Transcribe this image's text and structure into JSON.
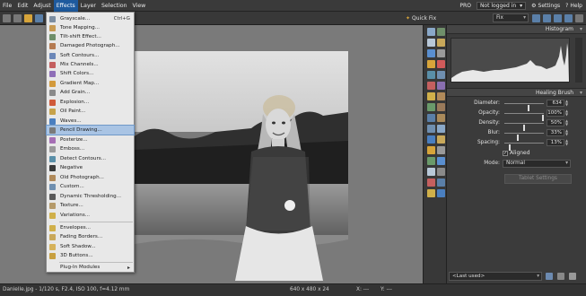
{
  "menubar": {
    "items": [
      "File",
      "Edit",
      "Adjust",
      "Effects",
      "Layer",
      "Selection",
      "View"
    ],
    "pro_label": "PRO",
    "login_label": "Not logged in",
    "settings_label": "Settings",
    "help_label": "Help"
  },
  "toolbar": {
    "quick_fix_label": "Quick Fix",
    "fix_value": "Fix"
  },
  "effects_menu": {
    "items": [
      {
        "label": "Grayscale...",
        "shortcut": "Ctrl+G",
        "color": "#7c8da0"
      },
      {
        "label": "Tone Mapping...",
        "color": "#c79a52"
      },
      {
        "label": "Tilt-shift Effect...",
        "color": "#6f8f6a"
      },
      {
        "label": "Damaged Photograph...",
        "color": "#b57b52"
      },
      {
        "label": "Soft Contours...",
        "color": "#6b87b8"
      },
      {
        "label": "Mix Channels...",
        "color": "#c45f5f"
      },
      {
        "label": "Shift Colors...",
        "color": "#8f6fb8"
      },
      {
        "label": "Gradient Map...",
        "color": "#d39a3c"
      },
      {
        "label": "Add Grain...",
        "color": "#8a8a8a"
      },
      {
        "label": "Explosion...",
        "color": "#d05a3a"
      },
      {
        "label": "Oil Paint...",
        "color": "#c7a24a"
      },
      {
        "label": "Waves...",
        "color": "#4a7fc0"
      },
      {
        "label": "Pencil Drawing...",
        "color": "#7a7a7a"
      },
      {
        "label": "Posterize...",
        "color": "#a66fb5"
      },
      {
        "label": "Emboss...",
        "color": "#9a9a9a"
      },
      {
        "label": "Detect Contours...",
        "color": "#5a8fa8"
      },
      {
        "label": "Negative",
        "color": "#3a3a3a"
      },
      {
        "label": "Old Photograph...",
        "color": "#b08a5a"
      },
      {
        "label": "Custom...",
        "color": "#6f8fb0"
      },
      {
        "label": "Dynamic Thresholding...",
        "color": "#5a5a5a"
      },
      {
        "label": "Texture...",
        "color": "#b59a6a"
      },
      {
        "label": "Variations...",
        "color": "#d0b04a"
      },
      {
        "label": "Envelopes...",
        "color": "#d0b04a"
      },
      {
        "label": "Fading Borders...",
        "color": "#c9a85a"
      },
      {
        "label": "Soft Shadow...",
        "color": "#d6b25a"
      },
      {
        "label": "3D Buttons...",
        "color": "#c8a040"
      },
      {
        "label": "Plug-In Modules",
        "color": "#c8a040"
      }
    ],
    "highlighted_label": "Pencil Drawing..."
  },
  "panel": {
    "histogram_title": "Histogram",
    "brush_title": "Healing Brush",
    "params": [
      {
        "label": "Diameter:",
        "value": "634",
        "level": 0.62
      },
      {
        "label": "Opacity:",
        "value": "100%",
        "level": 1.0
      },
      {
        "label": "Density:",
        "value": "50%",
        "level": 0.5
      },
      {
        "label": "Blur:",
        "value": "33%",
        "level": 0.33
      },
      {
        "label": "Spacing:",
        "value": "13%",
        "level": 0.13
      }
    ],
    "aligned_label": "Aligned",
    "mode_label": "Mode:",
    "mode_value": "Normal",
    "tablet_label": "Tablet Settings",
    "last_used": "<Last used>"
  },
  "status": {
    "file_info": "Danielle.jpg - 1/120 s, F2.4, ISO 100, f=4.12 mm",
    "dims": "640 x 480 x 24",
    "x_label": "X: ---",
    "y_label": "Y: ---"
  },
  "colors": {
    "menu_highlight": "#1e5a9e",
    "item_highlight": "#a9c4e4"
  }
}
